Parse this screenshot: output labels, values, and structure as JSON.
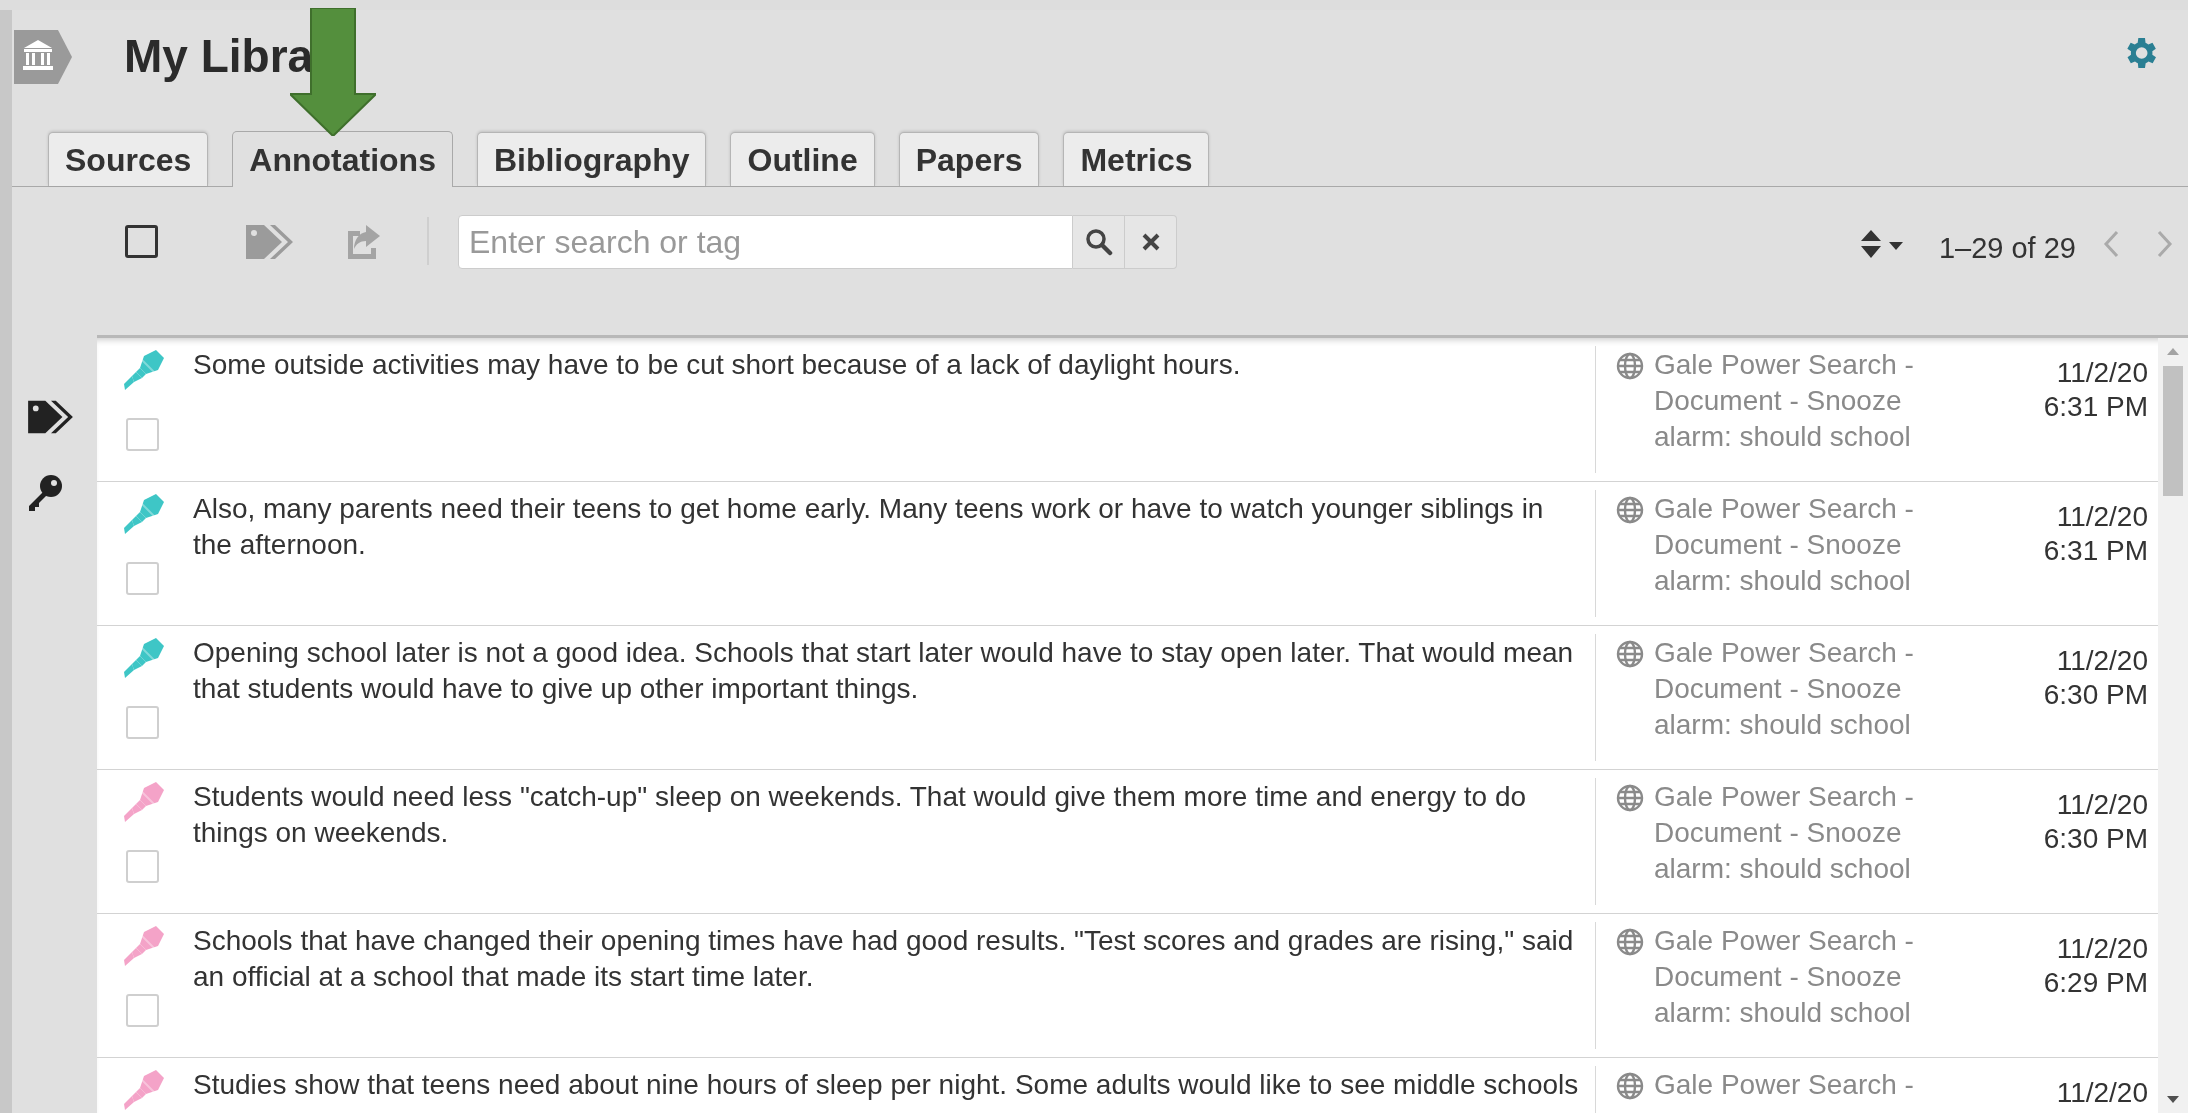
{
  "header": {
    "title": "My Libra"
  },
  "tabs": [
    {
      "label": "Sources",
      "selected": false
    },
    {
      "label": "Annotations",
      "selected": true
    },
    {
      "label": "Bibliography",
      "selected": false
    },
    {
      "label": "Outline",
      "selected": false
    },
    {
      "label": "Papers",
      "selected": false
    },
    {
      "label": "Metrics",
      "selected": false
    }
  ],
  "toolbar": {
    "select_all": {
      "checked": false
    },
    "search": {
      "placeholder": "Enter search or tag"
    },
    "pagination": "1–29 of 29"
  },
  "annotations": [
    {
      "text": "Some outside activities may have to be cut short because of a lack of daylight hours.",
      "color": "#3ec6c6",
      "checked": false,
      "source": "Gale Power Search - Document - Snooze alarm: should school",
      "date": "11/2/20",
      "time": "6:31 PM"
    },
    {
      "text": "Also, many parents need their teens to get home early. Many teens work or have to watch younger siblings in the afternoon.",
      "color": "#3ec6c6",
      "checked": false,
      "source": "Gale Power Search - Document - Snooze alarm: should school",
      "date": "11/2/20",
      "time": "6:31 PM"
    },
    {
      "text": "Opening school later is not a good idea. Schools that start later would have to stay open later. That would mean that students would have to give up other important things.",
      "color": "#3ec6c6",
      "checked": false,
      "source": "Gale Power Search - Document - Snooze alarm: should school",
      "date": "11/2/20",
      "time": "6:30 PM"
    },
    {
      "text": "Students would need less \"catch-up\" sleep on weekends. That would give them more time and energy to do things on weekends.",
      "color": "#f4a3c8",
      "checked": false,
      "source": "Gale Power Search - Document - Snooze alarm: should school",
      "date": "11/2/20",
      "time": "6:30 PM"
    },
    {
      "text": "Schools that have changed their opening times have had good results. \"Test scores and grades are rising,\" said an official at a school that made its start time later.",
      "color": "#f4a3c8",
      "checked": false,
      "source": "Gale Power Search - Document - Snooze alarm: should school",
      "date": "11/2/20",
      "time": "6:29 PM"
    },
    {
      "text": "Studies show that teens need about nine hours of sleep per night. Some adults would like to see middle schools",
      "color": "#f4a3c8",
      "source": "Gale Power Search -",
      "date": "11/2/20"
    }
  ]
}
